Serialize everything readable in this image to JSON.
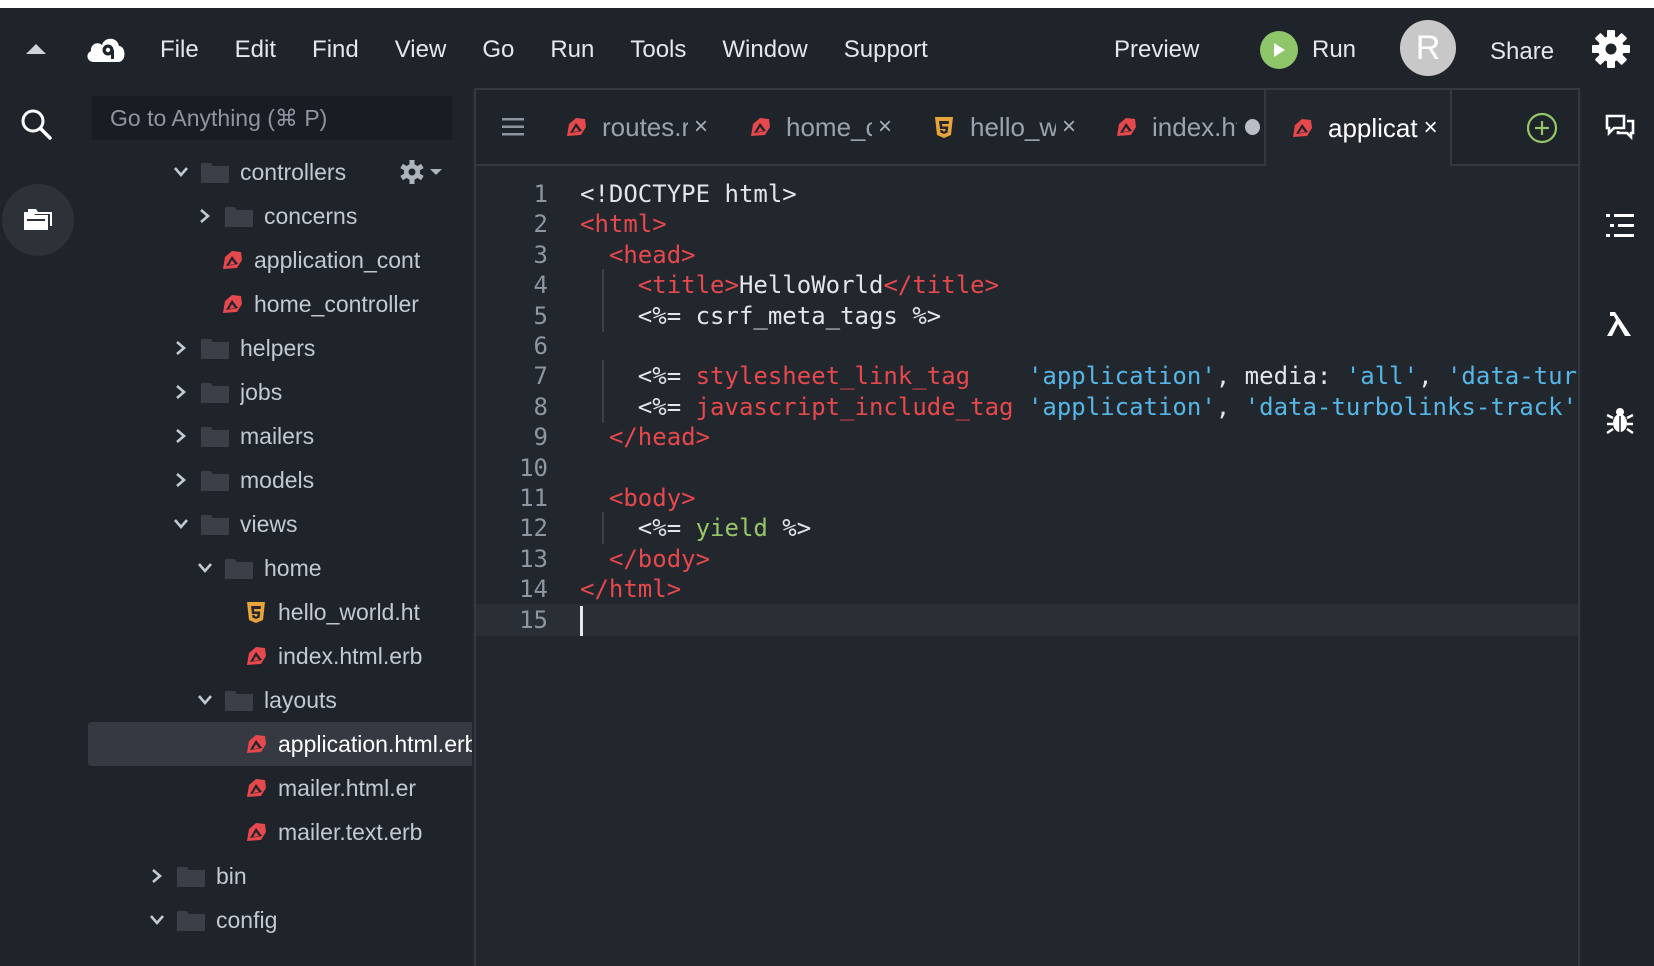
{
  "menubar": {
    "items": [
      "File",
      "Edit",
      "Find",
      "View",
      "Go",
      "Run",
      "Tools",
      "Window",
      "Support"
    ],
    "preview_label": "Preview",
    "run_label": "Run",
    "avatar_initial": "R",
    "share_label": "Share"
  },
  "sidebar": {
    "search_placeholder": "Go to Anything (⌘ P)",
    "tree": [
      {
        "label": "controllers",
        "kind": "folder",
        "expanded": true
      },
      {
        "label": "concerns",
        "kind": "folder",
        "expanded": false
      },
      {
        "label": "application_cont",
        "kind": "ruby"
      },
      {
        "label": "home_controller",
        "kind": "ruby"
      },
      {
        "label": "helpers",
        "kind": "folder",
        "expanded": false
      },
      {
        "label": "jobs",
        "kind": "folder",
        "expanded": false
      },
      {
        "label": "mailers",
        "kind": "folder",
        "expanded": false
      },
      {
        "label": "models",
        "kind": "folder",
        "expanded": false
      },
      {
        "label": "views",
        "kind": "folder",
        "expanded": true
      },
      {
        "label": "home",
        "kind": "folder",
        "expanded": true
      },
      {
        "label": "hello_world.ht",
        "kind": "html"
      },
      {
        "label": "index.html.erb",
        "kind": "ruby"
      },
      {
        "label": "layouts",
        "kind": "folder",
        "expanded": true
      },
      {
        "label": "application.html.erb",
        "kind": "ruby",
        "selected": true
      },
      {
        "label": "mailer.html.er",
        "kind": "ruby"
      },
      {
        "label": "mailer.text.erb",
        "kind": "ruby"
      },
      {
        "label": "bin",
        "kind": "folder",
        "expanded": false
      },
      {
        "label": "config",
        "kind": "folder",
        "expanded": true
      }
    ]
  },
  "editor": {
    "tabs": [
      {
        "label": "routes.r",
        "kind": "ruby",
        "state": "close"
      },
      {
        "label": "home_c",
        "kind": "ruby",
        "state": "close"
      },
      {
        "label": "hello_w",
        "kind": "html",
        "state": "close"
      },
      {
        "label": "index.ht",
        "kind": "ruby",
        "state": "modified"
      },
      {
        "label": "applicat",
        "kind": "ruby",
        "state": "close",
        "active": true
      }
    ],
    "close_glyph": "×",
    "lines": [
      [
        [
          "plain",
          "<!DOCTYPE html>"
        ]
      ],
      [
        [
          "tag",
          "<html>"
        ]
      ],
      [
        [
          "plain",
          "  "
        ],
        [
          "tag",
          "<head>"
        ]
      ],
      [
        [
          "plain",
          "    "
        ],
        [
          "tag",
          "<title>"
        ],
        [
          "plain",
          "HelloWorld"
        ],
        [
          "tag",
          "</title>"
        ]
      ],
      [
        [
          "plain",
          "    <%= csrf_meta_tags %>"
        ]
      ],
      [
        [
          "plain",
          ""
        ]
      ],
      [
        [
          "plain",
          "    <%= "
        ],
        [
          "helper",
          "stylesheet_link_tag"
        ],
        [
          "plain",
          "    "
        ],
        [
          "str",
          "'application'"
        ],
        [
          "plain",
          ", media: "
        ],
        [
          "str",
          "'all'"
        ],
        [
          "plain",
          ", "
        ],
        [
          "str",
          "'data-turbolinks-track'"
        ]
      ],
      [
        [
          "plain",
          "    <%= "
        ],
        [
          "helper",
          "javascript_include_tag"
        ],
        [
          "plain",
          " "
        ],
        [
          "str",
          "'application'"
        ],
        [
          "plain",
          ", "
        ],
        [
          "str",
          "'data-turbolinks-track'"
        ],
        [
          "plain",
          ": "
        ]
      ],
      [
        [
          "plain",
          "  "
        ],
        [
          "tag",
          "</head>"
        ]
      ],
      [
        [
          "plain",
          ""
        ]
      ],
      [
        [
          "plain",
          "  "
        ],
        [
          "tag",
          "<body>"
        ]
      ],
      [
        [
          "plain",
          "    <%= "
        ],
        [
          "kw",
          "yield"
        ],
        [
          "plain",
          " %>"
        ]
      ],
      [
        [
          "plain",
          "  "
        ],
        [
          "tag",
          "</body>"
        ]
      ],
      [
        [
          "tag",
          "</html>"
        ]
      ],
      [
        [
          "plain",
          ""
        ]
      ]
    ],
    "current_line": 15
  },
  "colors": {
    "background": "#22262d",
    "chrome": "#1f232a",
    "ruby_red": "#e5484d",
    "string_blue": "#56b6e6",
    "keyword_green": "#97c668",
    "html_orange": "#e8a33d",
    "run_green": "#8fc66a"
  },
  "icons": {
    "top_right": "gear-icon",
    "right_rail": [
      "chat-icon",
      "outline-list-icon",
      "lambda-icon",
      "bug-icon"
    ]
  }
}
